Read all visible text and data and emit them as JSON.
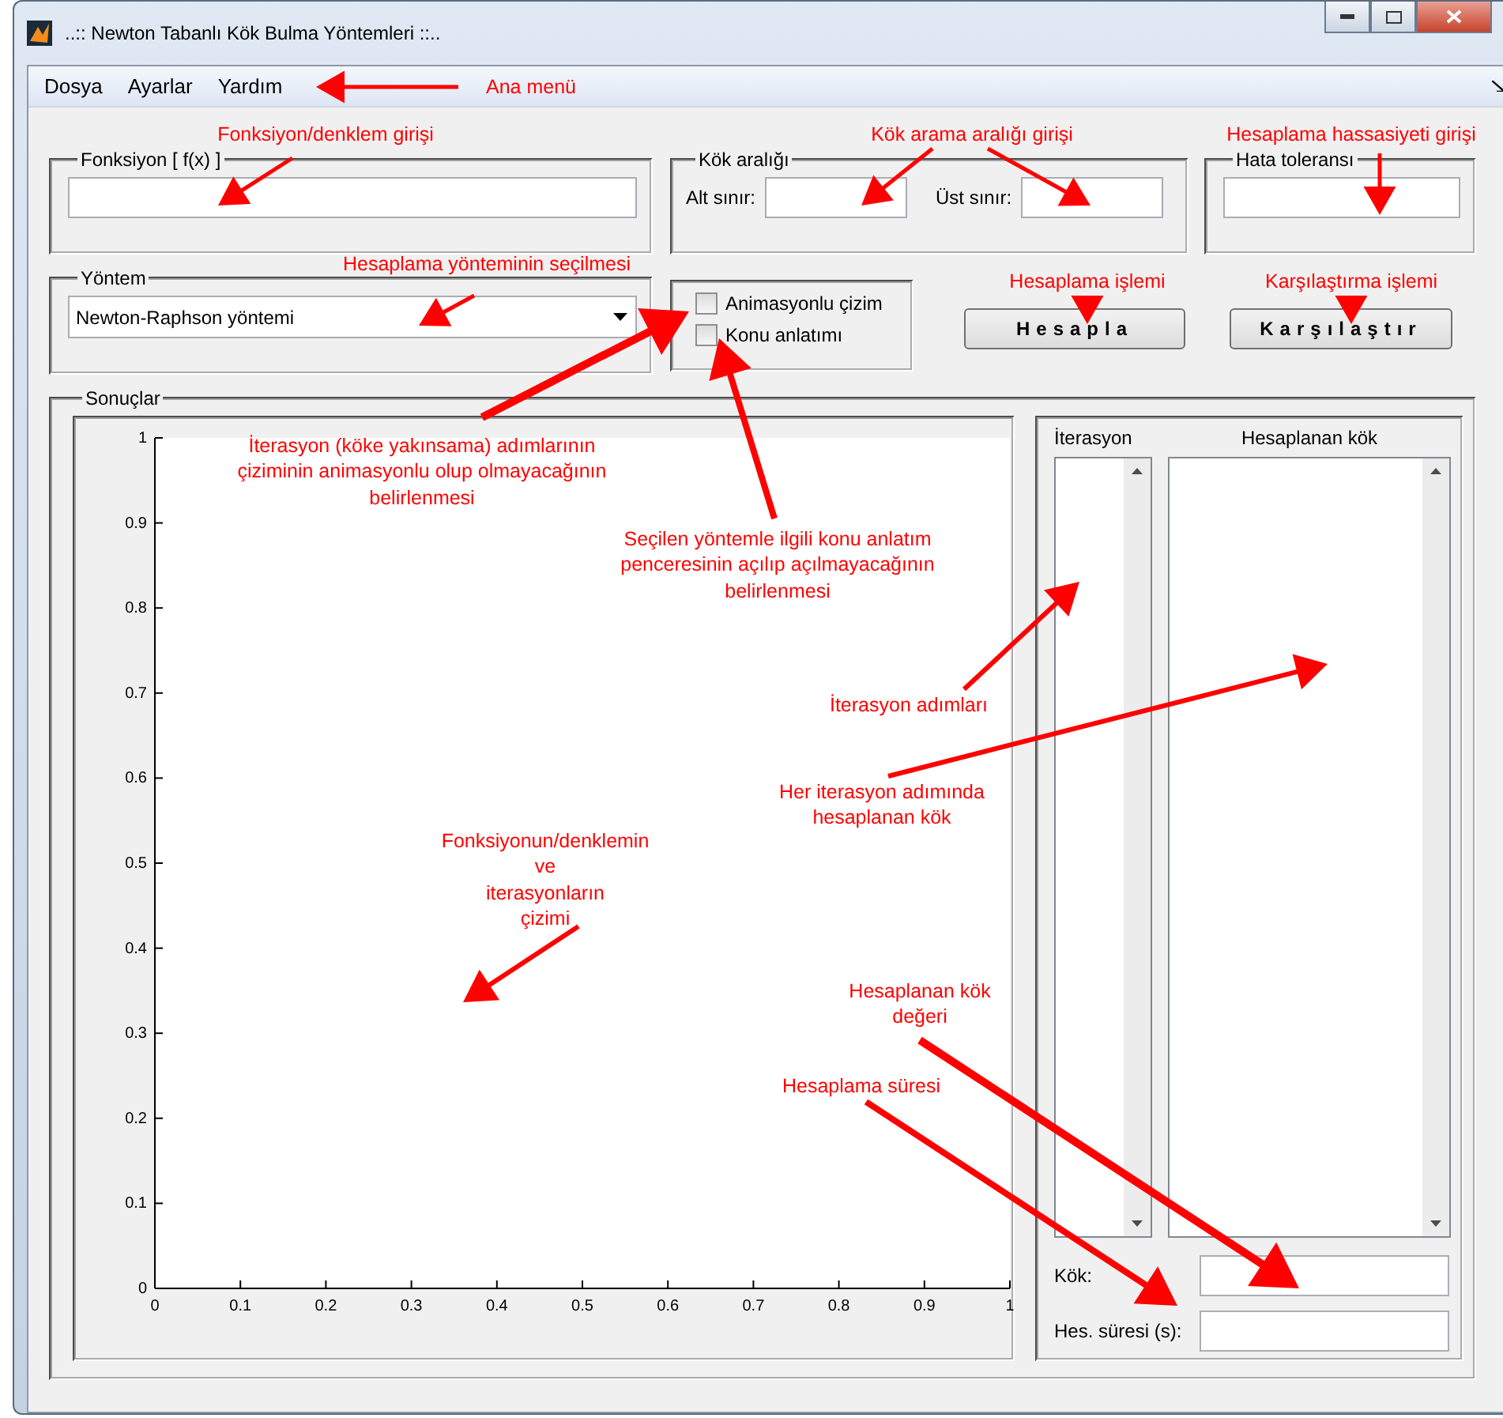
{
  "window": {
    "title": "..:: Newton Tabanlı Kök Bulma Yöntemleri ::.."
  },
  "menu": [
    "Dosya",
    "Ayarlar",
    "Yardım"
  ],
  "function_panel": {
    "title": "Fonksiyon [ f(x) ]"
  },
  "interval_panel": {
    "title": "Kök aralığı",
    "lower_label": "Alt sınır:",
    "upper_label": "Üst sınır:"
  },
  "tolerance_panel": {
    "title": "Hata toleransı"
  },
  "method_panel": {
    "title": "Yöntem",
    "selected_method": "Newton-Raphson yöntemi"
  },
  "options": [
    {
      "label": "Animasyonlu çizim",
      "checked": false
    },
    {
      "label": "Konu anlatımı",
      "checked": false
    }
  ],
  "buttons": [
    "Hesapla",
    "Karşılaştır"
  ],
  "results": {
    "title": "Sonuçlar",
    "chart_data": {
      "type": "line",
      "xlim": [
        0,
        1
      ],
      "ylim": [
        0,
        1
      ],
      "xticks": [
        0,
        0.1,
        0.2,
        0.3,
        0.4,
        0.5,
        0.6,
        0.7,
        0.8,
        0.9,
        1
      ],
      "yticks": [
        0,
        0.1,
        0.2,
        0.3,
        0.4,
        0.5,
        0.6,
        0.7,
        0.8,
        0.9,
        1
      ]
    },
    "iteration_header": "İterasyon",
    "root_header": "Hesaplanan kök",
    "root_label": "Kök:",
    "time_label": "Hes. süresi (s):"
  },
  "annotations": [
    "Ana menü",
    "Fonksiyon/denklem girişi",
    "Kök arama aralığı girişi",
    "Hesaplama hassasiyeti girişi",
    "Hesaplama yönteminin seçilmesi",
    "Hesaplama işlemi",
    "Karşılaştırma işlemi",
    "İterasyon (köke yakınsama) adımlarının\nçiziminin animasyonlu olup olmayacağının\nbelirlenmesi",
    "Seçilen yöntemle ilgili konu anlatım\npenceresinin açılıp açılmayacağının\nbelirlenmesi",
    "İterasyon adımları",
    "Her iterasyon adımında\nhesaplanan kök",
    "Fonksiyonun/denklemin\nve\niterasyonların\nçizimi",
    "Hesaplanan kök\ndeğeri",
    "Hesaplama süresi"
  ]
}
